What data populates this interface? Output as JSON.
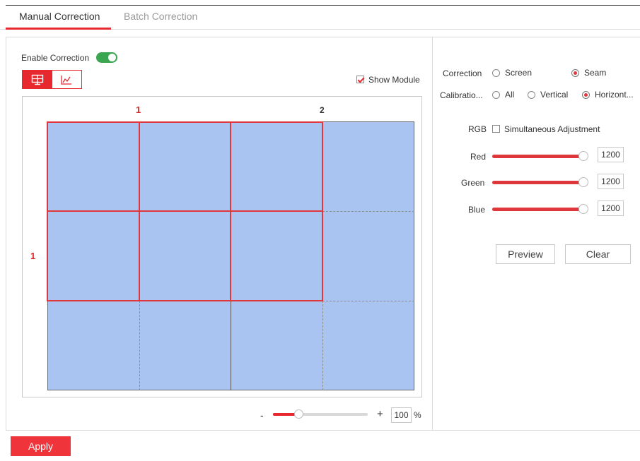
{
  "tabs": [
    {
      "label": "Manual Correction",
      "active": true
    },
    {
      "label": "Batch Correction",
      "active": false
    }
  ],
  "left": {
    "enable_label": "Enable Correction",
    "enable_on": true,
    "view_buttons": [
      "grid-view-icon",
      "curve-view-icon"
    ],
    "show_module_label": "Show Module",
    "show_module_checked": true,
    "column_labels": [
      "1",
      "2"
    ],
    "row_labels": [
      "1"
    ],
    "zoom_minus": "-",
    "zoom_plus": "+",
    "zoom_value": "100",
    "zoom_unit": "%",
    "zoom_fraction": 0.27
  },
  "right": {
    "correction_label": "Correction",
    "correction_options": [
      "Screen",
      "Seam"
    ],
    "correction_selected": "Seam",
    "calibration_label": "Calibratio...",
    "calibration_options": [
      "All",
      "Vertical",
      "Horizont..."
    ],
    "calibration_selected": "Horizont...",
    "rgb_label": "RGB",
    "simultaneous_label": "Simultaneous Adjustment",
    "simultaneous_checked": false,
    "channels": [
      {
        "label": "Red",
        "value": "1200",
        "fraction": 1.0
      },
      {
        "label": "Green",
        "value": "1200",
        "fraction": 1.0
      },
      {
        "label": "Blue",
        "value": "1200",
        "fraction": 1.0
      }
    ],
    "preview_label": "Preview",
    "clear_label": "Clear"
  },
  "footer": {
    "apply_label": "Apply"
  },
  "colors": {
    "accent": "#e8282f",
    "toggle_on": "#3ba651",
    "screen_fill": "#a9c4f0"
  }
}
